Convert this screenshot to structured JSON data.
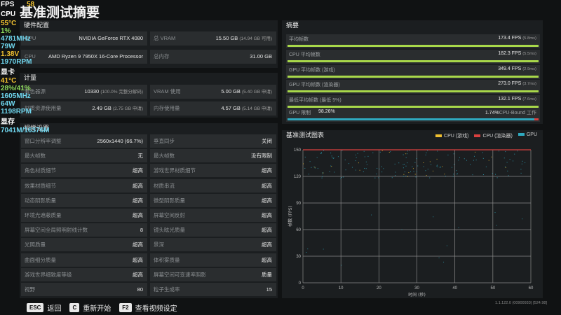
{
  "page": {
    "title": "基准测试摘要"
  },
  "overlay": {
    "fps_label": "FPS",
    "fps_value": "58",
    "cpu_label": "CPU",
    "cpu_temp": "55°C",
    "cpu_usage": "1%",
    "cpu_clock": "4781MHz",
    "cpu_power": "79W",
    "cpu_voltage": "1.38V",
    "cpu_fan": "1970RPM",
    "gpu_label": "显卡",
    "gpu_temp": "41°C",
    "gpu_usage": "28%/41%",
    "gpu_clock": "1605MHz",
    "gpu_power": "64W",
    "gpu_fan": "1198RPM",
    "vram_label": "显存",
    "vram_value": "7041M/16376M"
  },
  "hardware": {
    "title": "硬件配置",
    "gpu_label": "GPU",
    "gpu_value": "NVIDIA GeForce RTX 4080",
    "vram_label": "总 VRAM",
    "vram_value": "15.50 GB",
    "vram_detail": "(14.94 GB 可用)",
    "cpu_label": "CPU",
    "cpu_value": "AMD Ryzen 9 7950X 16-Core Processor",
    "mem_label": "总内存",
    "mem_value": "31.00 GB"
  },
  "compute": {
    "title": "计量",
    "shader_label": "着色器源",
    "shader_value": "10330",
    "shader_detail": "(100.0% 完整分解码)",
    "vram_use_label": "VRAM 使用",
    "vram_use_value": "5.00 GB",
    "vram_use_detail": "(5.40 GB 申请)",
    "texmem_label": "材质资源使用量",
    "texmem_value": "2.49 GB",
    "texmem_detail": "(2.75 GB 申请)",
    "memuse_label": "内存使用量",
    "memuse_value": "4.57 GB",
    "memuse_detail": "(5.14 GB 申请)"
  },
  "settings": {
    "title": "视觉设置",
    "rows": [
      {
        "l_label": "窗口分辨率调整",
        "l_value": "2560x1440 (66.7%)",
        "r_label": "垂直同步",
        "r_value": "关闭"
      },
      {
        "l_label": "最大帧数",
        "l_value": "无",
        "r_label": "最大帧数",
        "r_value": "没有限制"
      },
      {
        "l_label": "角色材质细节",
        "l_value": "超高",
        "r_label": "游戏世界材质细节",
        "r_value": "超高"
      },
      {
        "l_label": "效果材质细节",
        "l_value": "超高",
        "r_label": "材质串流",
        "r_value": "超高"
      },
      {
        "l_label": "动态阴影质量",
        "l_value": "超高",
        "r_label": "微型阴影质量",
        "r_value": "超高"
      },
      {
        "l_label": "环境光遮蔽质量",
        "l_value": "超高",
        "r_label": "屏幕空间反射",
        "r_value": "超高"
      },
      {
        "l_label": "屏幕空间全局照明射线计数",
        "l_value": "8",
        "r_label": "镜头眩光质量",
        "r_value": "超高"
      },
      {
        "l_label": "光照质量",
        "l_value": "超高",
        "r_label": "景深",
        "r_value": "超高"
      },
      {
        "l_label": "曲面细分质量",
        "l_value": "超高",
        "r_label": "体积雾质量",
        "r_value": "超高"
      },
      {
        "l_label": "游戏世界细致度等级",
        "l_value": "超高",
        "r_label": "屏幕空间可变速率阴影",
        "r_value": "质量"
      },
      {
        "l_label": "视野",
        "l_value": "80",
        "r_label": "粒子生成率",
        "r_value": "15"
      }
    ]
  },
  "summary": {
    "title": "摘要",
    "rows": [
      {
        "label": "平均帧数",
        "value": "173.4 FPS",
        "detail": "(5.8ms)",
        "bar_fraction": 1.0
      },
      {
        "label": "CPU 平均帧数",
        "value": "182.3 FPS",
        "detail": "(5.5ms)",
        "bar_fraction": 1.0
      },
      {
        "label": "GPU 平均帧数 (游戏)",
        "value": "349.4 FPS",
        "detail": "(2.9ms)",
        "bar_fraction": 1.0
      },
      {
        "label": "GPU 平均帧数 (渲染器)",
        "value": "273.0 FPS",
        "detail": "(3.7ms)",
        "bar_fraction": 1.0
      },
      {
        "label": "最低平均帧数 (最低 5%)",
        "value": "132.1 FPS",
        "detail": "(7.6ms)",
        "bar_fraction": 1.0
      }
    ],
    "gpu_limit_label": "GPU 限制",
    "gpu_limit_pct": "98.26%",
    "gpu_limit_fraction": 0.9826,
    "cpu_bound_pct": "1.74%",
    "cpu_bound_label": "CPU-Bound 工作"
  },
  "chart_data": {
    "type": "scatter",
    "title": "基准测试图表",
    "xlabel": "时间 (秒)",
    "ylabel": "帧数 (FPS)",
    "xlim": [
      0,
      60
    ],
    "ylim": [
      0,
      150
    ],
    "xticks": [
      0,
      10,
      20,
      30,
      40,
      50,
      60
    ],
    "yticks": [
      0,
      30,
      60,
      90,
      120,
      150
    ],
    "grid": true,
    "legend_position": "top-right",
    "reference_line": 150,
    "series": [
      {
        "name": "CPU (游戏)",
        "color": "#f0c030"
      },
      {
        "name": "CPU (渲染器)",
        "color": "#d9403f"
      },
      {
        "name": "GPU",
        "color": "#2fa9bf"
      }
    ]
  },
  "footer": {
    "back_key": "ESC",
    "back_label": "返回",
    "restart_key": "C",
    "restart_label": "重新开始",
    "settings_key": "F2",
    "settings_label": "查看视频设定"
  },
  "version": "1.1.122.0 (00900933) [524.98]",
  "colors": {
    "background": "#101213",
    "panel": "#1b1e20",
    "cell": "#2a2d2f",
    "bar_green": "#a8d84a",
    "bar_teal": "#2fa9bf",
    "bar_red": "#d9403f"
  }
}
